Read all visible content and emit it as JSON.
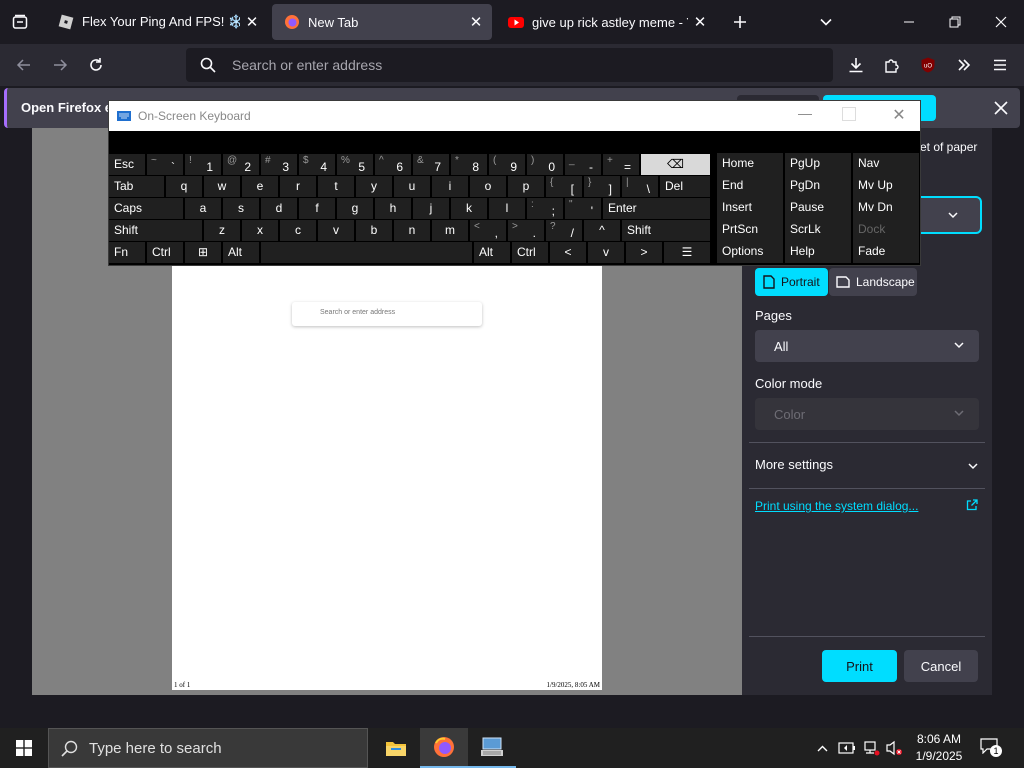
{
  "browser": {
    "tabs": [
      {
        "title": "Flex Your Ping And FPS! ❄️ - Ro",
        "active": false
      },
      {
        "title": "New Tab",
        "active": true
      },
      {
        "title": "give up rick astley meme - YouT",
        "active": false
      }
    ],
    "url_placeholder": "Search or enter address",
    "notification_text": "Open Firefox ev"
  },
  "preview": {
    "search_placeholder": "Search or enter address",
    "footer_left": "1 of 1",
    "footer_right": "1/9/2025, 8:05 AM"
  },
  "print_panel": {
    "sheets_text": "et of paper",
    "portrait_label": "Portrait",
    "landscape_label": "Landscape",
    "pages_label": "Pages",
    "pages_value": "All",
    "color_mode_label": "Color mode",
    "color_mode_value": "Color",
    "more_settings_label": "More settings",
    "system_dialog_link": "Print using the system dialog...",
    "print_button": "Print",
    "cancel_button": "Cancel"
  },
  "keyboard": {
    "title": "On-Screen Keyboard",
    "rows": {
      "r1": [
        "Esc",
        "~ `",
        "! 1",
        "@ 2",
        "# 3",
        "$ 4",
        "% 5",
        "^ 6",
        "& 7",
        "* 8",
        "( 9",
        ") 0",
        "_ -",
        "+ =",
        "⌫"
      ],
      "r2": [
        "Tab",
        "q",
        "w",
        "e",
        "r",
        "t",
        "y",
        "u",
        "i",
        "o",
        "p",
        "{ [",
        "} ]",
        "| \\",
        "Del"
      ],
      "r3": [
        "Caps",
        "a",
        "s",
        "d",
        "f",
        "g",
        "h",
        "j",
        "k",
        "l",
        ": ;",
        "\" '",
        "Enter"
      ],
      "r4": [
        "Shift",
        "z",
        "x",
        "c",
        "v",
        "b",
        "n",
        "m",
        "< ,",
        "> .",
        "? /",
        "^",
        "Shift"
      ],
      "r5": [
        "Fn",
        "Ctrl",
        "⊞",
        "Alt",
        "Alt",
        "Ctrl",
        "<",
        "v",
        ">",
        "☰"
      ]
    },
    "nav_keys": [
      [
        "Home",
        "PgUp",
        "Nav"
      ],
      [
        "End",
        "PgDn",
        "Mv Up"
      ],
      [
        "Insert",
        "Pause",
        "Mv Dn"
      ],
      [
        "PrtScn",
        "ScrLk",
        "Dock"
      ],
      [
        "Options",
        "Help",
        "Fade"
      ]
    ]
  },
  "taskbar": {
    "search_placeholder": "Type here to search",
    "time": "8:06 AM",
    "date": "1/9/2025",
    "notification_count": "1"
  },
  "colors": {
    "accent": "#00ddff",
    "panel_bg": "#2b2a33",
    "toolbar_bg": "#1c1b22",
    "notif_accent": "#a66efd"
  }
}
